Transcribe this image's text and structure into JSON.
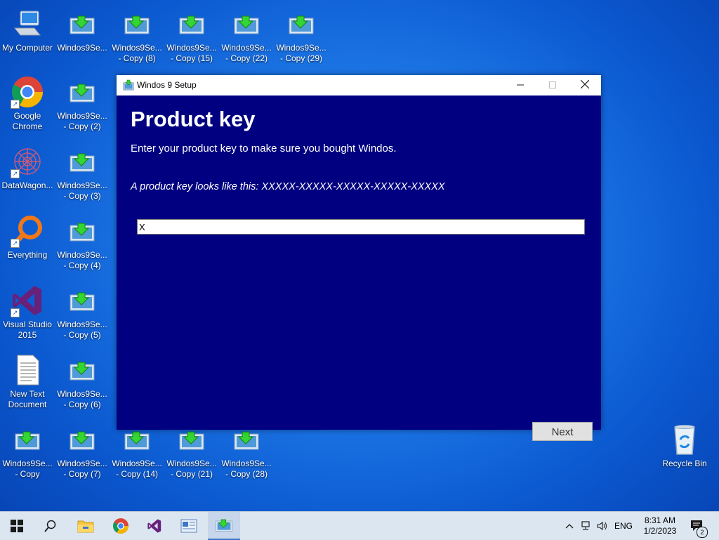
{
  "desktop": {
    "icons_col1": [
      {
        "label": "My Computer",
        "icon": "my-computer-icon"
      },
      {
        "label": "Google\nChrome",
        "icon": "chrome-icon"
      },
      {
        "label": "DataWagon...",
        "icon": "datawagon-icon"
      },
      {
        "label": "Everything",
        "icon": "everything-icon"
      },
      {
        "label": "Visual Studio\n2015",
        "icon": "visual-studio-icon"
      },
      {
        "label": "New Text\nDocument",
        "icon": "text-document-icon"
      },
      {
        "label": "Windos9Se...\n- Copy",
        "icon": "setup-icon"
      }
    ],
    "icons_col2": [
      {
        "label": "Windos9Se..."
      },
      {
        "label": "Windos9Se...\n- Copy (2)"
      },
      {
        "label": "Windos9Se...\n- Copy (3)"
      },
      {
        "label": "Windos9Se...\n- Copy (4)"
      },
      {
        "label": "Windos9Se...\n- Copy (5)"
      },
      {
        "label": "Windos9Se...\n- Copy (6)"
      },
      {
        "label": "Windos9Se...\n- Copy (7)"
      }
    ],
    "top_row": [
      {
        "label": "Windos9Se...\n- Copy (8)"
      },
      {
        "label": "Windos9Se...\n- Copy (15)"
      },
      {
        "label": "Windos9Se...\n- Copy (22)"
      },
      {
        "label": "Windos9Se...\n- Copy (29)"
      }
    ],
    "bottom_row": [
      {
        "label": "Windos9Se...\n- Copy (14)"
      },
      {
        "label": "Windos9Se...\n- Copy (21)"
      },
      {
        "label": "Windos9Se...\n- Copy (28)"
      }
    ],
    "recycle_bin": {
      "label": "Recycle Bin"
    }
  },
  "window": {
    "title": "Windos 9 Setup",
    "heading": "Product key",
    "subtext": "Enter your product key to make sure you bought Windos.",
    "hint": "A product key looks like this: XXXXX-XXXXX-XXXXX-XXXXX-XXXXX",
    "input_value": "X",
    "next_label": "Next"
  },
  "taskbar": {
    "language": "ENG",
    "time": "8:31 AM",
    "date": "1/2/2023",
    "notification_count": "2"
  },
  "colors": {
    "window_bg": "#000080",
    "desktop_accent": "#1f7ae8"
  }
}
